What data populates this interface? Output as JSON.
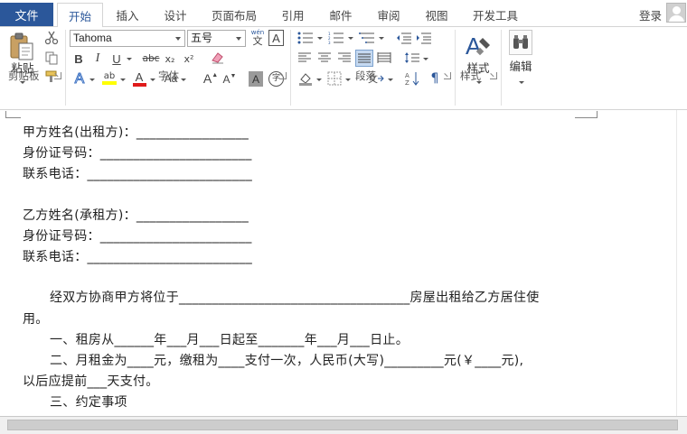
{
  "tabs": {
    "file": "文件",
    "items": [
      "开始",
      "插入",
      "设计",
      "页面布局",
      "引用",
      "邮件",
      "审阅",
      "视图",
      "开发工具"
    ],
    "active": "开始"
  },
  "account": {
    "login_label": "登录"
  },
  "ribbon": {
    "clipboard": {
      "label": "剪贴板",
      "paste_label": "粘贴"
    },
    "font": {
      "label": "字体",
      "font_name": "Tahoma",
      "font_size": "五号",
      "phonetic_label": "wén",
      "phonetic_char": "文",
      "char_border_label": "A",
      "bold": "B",
      "italic": "I",
      "underline": "U",
      "strike": "abc",
      "subscript": "x₂",
      "superscript": "x²",
      "text_effect": "A",
      "font_color": "A",
      "change_case": "Aa",
      "grow": "A",
      "shrink": "A",
      "char_shading": "A",
      "enclose_char": "字",
      "highlight": "ab",
      "accent_colors": {
        "highlight": "#ffff00",
        "font_color": "#e01b1b",
        "text_effect": "#3d72c3"
      }
    },
    "paragraph": {
      "label": "段落"
    },
    "styles": {
      "label": "样式",
      "button_label": "样式"
    },
    "editing": {
      "button_label": "编辑"
    }
  },
  "document": {
    "lines": [
      "甲方姓名(出租方)：_________________",
      "身份证号码：_______________________",
      "联系电话：_________________________",
      "乙方姓名(承租方)：_________________",
      "身份证号码：_______________________",
      "联系电话：_________________________",
      "经双方协商甲方将位于___________________________________房屋出租给乙方居住使",
      "用。",
      "一、租房从______年___月___日起至_______年___月___日止。",
      "二、月租金为____元，缴租为____支付一次，人民币(大写)_________元(￥____元),",
      "以后应提前___天支付。",
      "三、约定事项"
    ]
  }
}
